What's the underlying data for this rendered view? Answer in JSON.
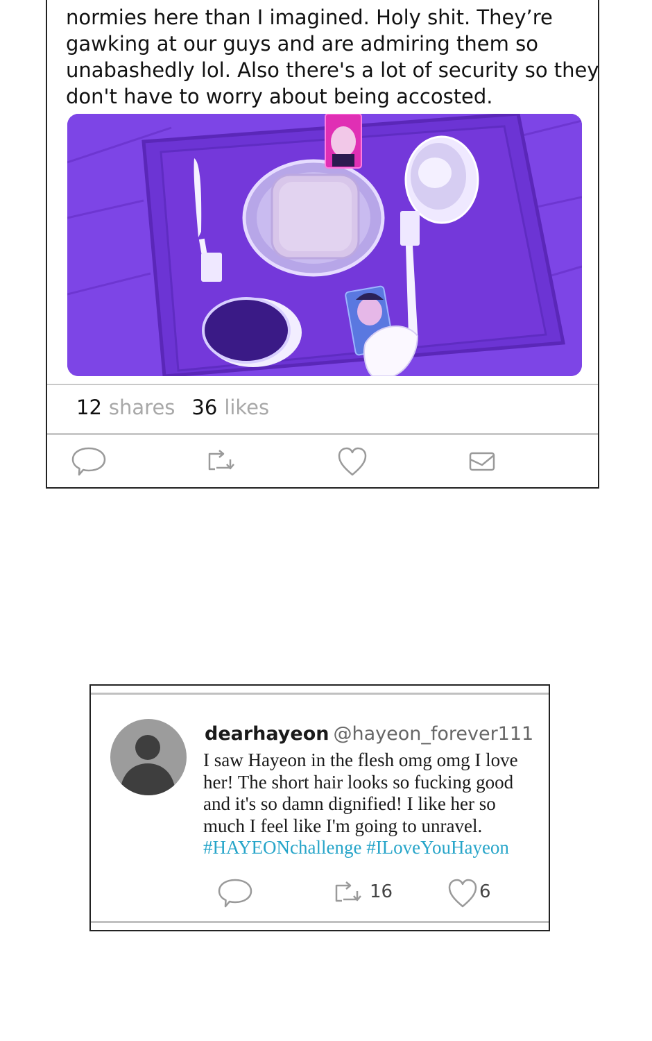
{
  "post1": {
    "text_lines": [
      "normies here than I imagined. Holy shit. They’re",
      "gawking at our guys and are admiring them so",
      "unabashedly lol. Also there's a lot of security so they",
      "don't have to worry about being accosted."
    ],
    "shares_count": "12",
    "shares_label": "shares",
    "likes_count": "36",
    "likes_label": "likes",
    "actions": [
      "reply-icon",
      "retweet-icon",
      "heart-icon",
      "mail-icon"
    ]
  },
  "post2": {
    "username": "dearhayeon",
    "handle": "@hayeon_forever111",
    "body_lines": [
      "I saw Hayeon in the flesh omg omg I love",
      "her! The short hair looks so fucking good",
      "and it's so damn dignified! I like her so",
      "much I feel like I'm going to unravel."
    ],
    "hashtags": "#HAYEONchallenge #ILoveYouHayeon",
    "retweet_count": "16",
    "like_count": "6",
    "actions": [
      "reply-icon",
      "retweet-icon",
      "heart-icon"
    ]
  },
  "colors": {
    "hashtag": "#27a5c9",
    "image_purple": "#7b3fe0",
    "border": "#222222"
  }
}
